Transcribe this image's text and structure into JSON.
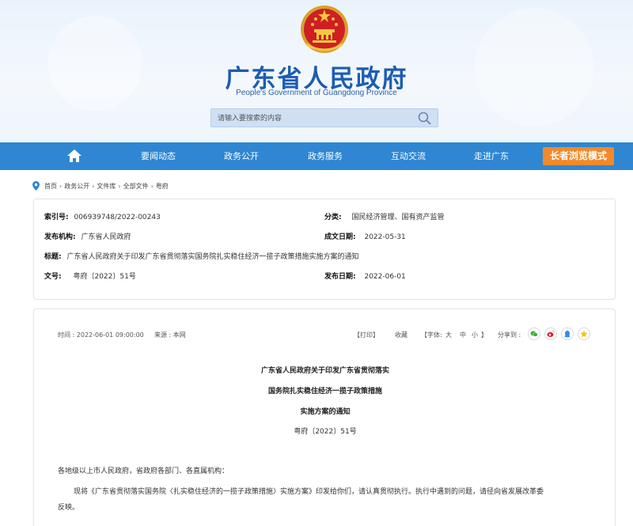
{
  "header": {
    "title": "广东省人民政府",
    "subtitle": "People's Government of Guangdong Province",
    "search_placeholder": "请输入要搜索的内容"
  },
  "nav": {
    "items": [
      "要闻动态",
      "政务公开",
      "政务服务",
      "互动交流",
      "走进广东"
    ],
    "elder_mode": "长者浏览模式"
  },
  "breadcrumb": [
    "首页",
    "政务公开",
    "文件库",
    "全部文件",
    "粤府"
  ],
  "info": {
    "index_label": "索引号:",
    "index_value": "006939748/2022-00243",
    "category_label": "分类:",
    "category_value": "国民经济管理、国有资产监管",
    "issuer_label": "发布机构:",
    "issuer_value": "广东省人民政府",
    "date_made_label": "成文日期:",
    "date_made_value": "2022-05-31",
    "title_label": "标题:",
    "title_value": "广东省人民政府关于印发广东省贯彻落实国务院扎实稳住经济一揽子政策措施实施方案的通知",
    "docno_label": "文号:",
    "docno_value": "粤府〔2022〕51号",
    "pubdate_label": "发布日期:",
    "pubdate_value": "2022-06-01"
  },
  "article": {
    "time": "时间 : 2022-06-01 09:00:00",
    "source": "来源 : 本网",
    "print": "【打印】",
    "favorite": "收藏",
    "font_label": "【字体:",
    "font_large": "大",
    "font_medium": "中",
    "font_small": "小",
    "font_close": "】",
    "share_label": "分享到 :",
    "share_icons": [
      "wechat-icon",
      "weibo-icon",
      "qq-icon",
      "qzone-icon"
    ],
    "title_line1": "广东省人民政府关于印发广东省贯彻落实",
    "title_line2": "国务院扎实稳住经济一揽子政策措施",
    "title_line3": "实施方案的通知",
    "doc_no": "粤府〔2022〕51号",
    "salutation": "各地级以上市人民政府，省政府各部门、各直属机构：",
    "para1": "现将《广东省贯彻落实国务院〈扎实稳住经济的一揽子政策措施〉实施方案》印发给你们，请认真贯彻执行。执行中遇到的问题，请径向省发展改革委",
    "para1_cont": "反映。"
  },
  "colors": {
    "brand_blue": "#2f86d2",
    "title_blue": "#1c5cb3",
    "elder_orange": "#f08a2a"
  }
}
